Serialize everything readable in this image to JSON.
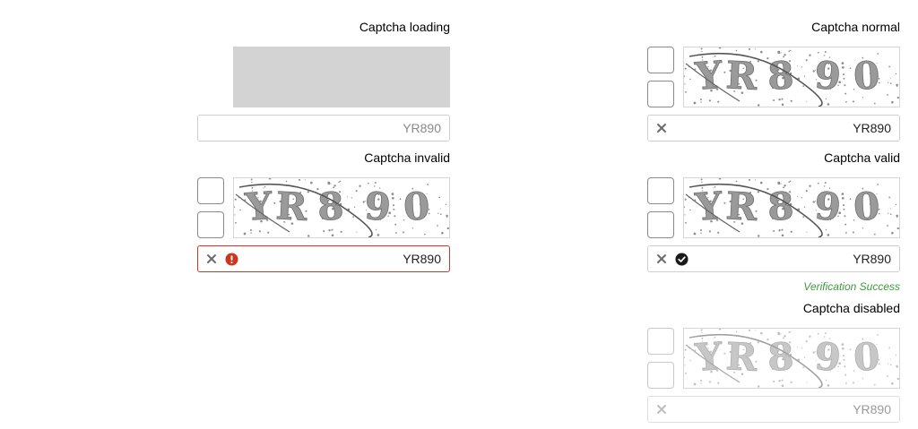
{
  "captchas": [
    {
      "id": "loading",
      "title": "Captcha loading",
      "value": "YR890",
      "value_is_placeholder": true,
      "status": "none"
    },
    {
      "id": "normal",
      "title": "Captcha normal",
      "value": "YR890",
      "value_is_placeholder": false,
      "status": "none"
    },
    {
      "id": "invalid",
      "title": "Captcha invalid",
      "value": "YR890",
      "value_is_placeholder": false,
      "status": "error"
    },
    {
      "id": "valid",
      "title": "Captcha valid",
      "value": "YR890",
      "value_is_placeholder": false,
      "status": "success",
      "message": "Verification Success"
    },
    {
      "id": "disabled",
      "title": "Captcha disabled",
      "value": "YR890",
      "value_is_placeholder": false,
      "status": "none"
    }
  ],
  "captcha_text": "YR890",
  "colors": {
    "error": "#c0392b",
    "success": "#3c9a3c",
    "loading": "#d3d3d3"
  },
  "icons": {
    "clear": "close-icon",
    "error": "error-icon",
    "success": "check-circle-icon"
  }
}
